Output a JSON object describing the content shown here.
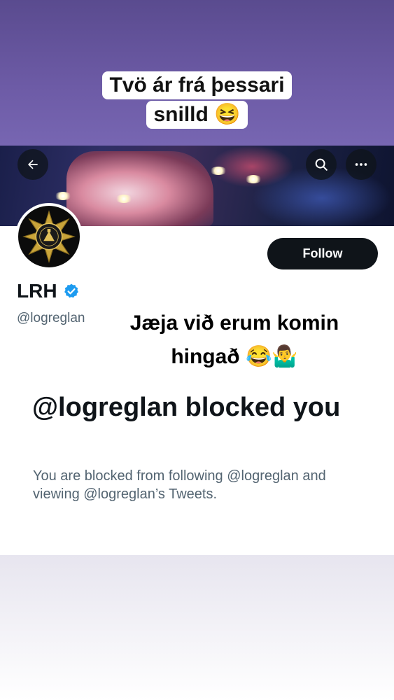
{
  "story": {
    "caption_line1": "Tvö ár frá þessari",
    "caption_line2": "snilld 😆",
    "overlay_line1": "Jæja við erum komin",
    "overlay_line2": "hingað 😂🤷‍♂️"
  },
  "profile": {
    "display_name": "LRH",
    "handle": "@logreglan",
    "follow_label": "Follow",
    "verified": true,
    "accent_color": "#1d9bf0"
  },
  "blocked": {
    "title": "@logreglan blocked you",
    "description": "You are blocked from following @logreglan and viewing @logreglan’s Tweets."
  },
  "icons": {
    "back": "back-arrow-icon",
    "search": "search-icon",
    "more": "more-horizontal-icon",
    "verified": "verified-badge-icon",
    "avatar": "police-badge-logo"
  }
}
